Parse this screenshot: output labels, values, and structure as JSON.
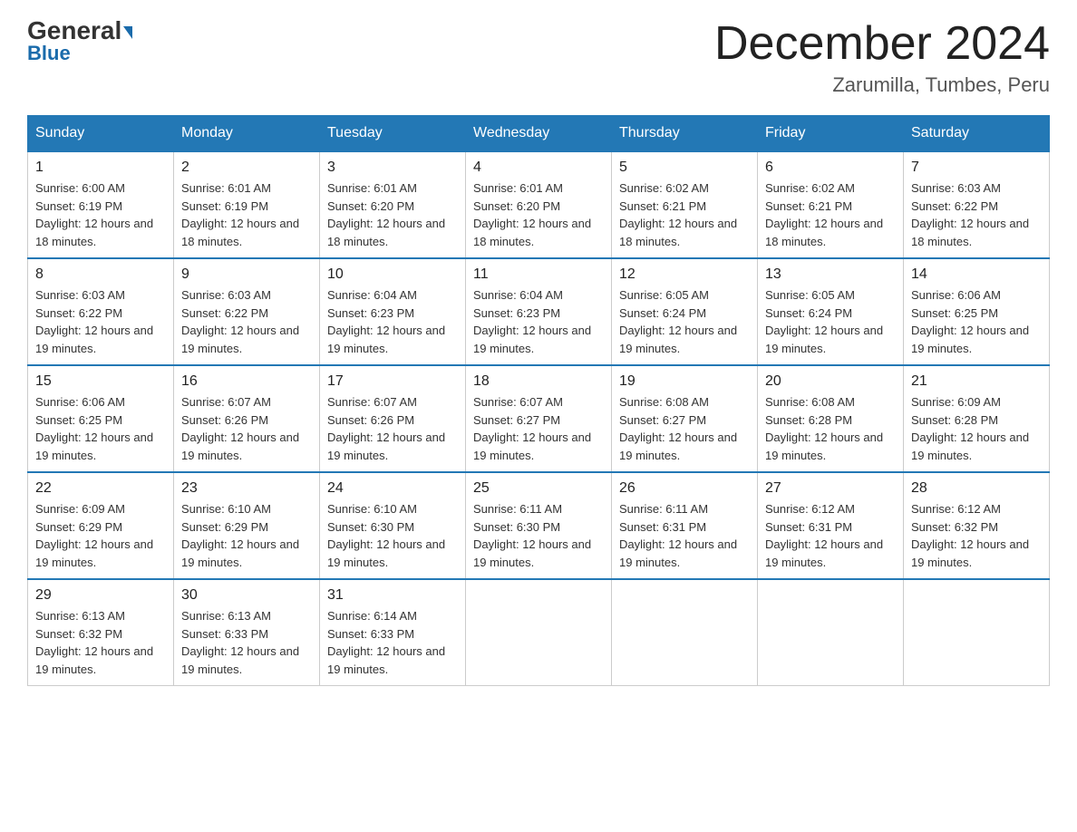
{
  "header": {
    "logo_text_general": "General",
    "logo_text_blue": "Blue",
    "month_title": "December 2024",
    "location": "Zarumilla, Tumbes, Peru"
  },
  "weekdays": [
    "Sunday",
    "Monday",
    "Tuesday",
    "Wednesday",
    "Thursday",
    "Friday",
    "Saturday"
  ],
  "weeks": [
    [
      {
        "day": "1",
        "sunrise": "6:00 AM",
        "sunset": "6:19 PM",
        "daylight": "12 hours and 18 minutes."
      },
      {
        "day": "2",
        "sunrise": "6:01 AM",
        "sunset": "6:19 PM",
        "daylight": "12 hours and 18 minutes."
      },
      {
        "day": "3",
        "sunrise": "6:01 AM",
        "sunset": "6:20 PM",
        "daylight": "12 hours and 18 minutes."
      },
      {
        "day": "4",
        "sunrise": "6:01 AM",
        "sunset": "6:20 PM",
        "daylight": "12 hours and 18 minutes."
      },
      {
        "day": "5",
        "sunrise": "6:02 AM",
        "sunset": "6:21 PM",
        "daylight": "12 hours and 18 minutes."
      },
      {
        "day": "6",
        "sunrise": "6:02 AM",
        "sunset": "6:21 PM",
        "daylight": "12 hours and 18 minutes."
      },
      {
        "day": "7",
        "sunrise": "6:03 AM",
        "sunset": "6:22 PM",
        "daylight": "12 hours and 18 minutes."
      }
    ],
    [
      {
        "day": "8",
        "sunrise": "6:03 AM",
        "sunset": "6:22 PM",
        "daylight": "12 hours and 19 minutes."
      },
      {
        "day": "9",
        "sunrise": "6:03 AM",
        "sunset": "6:22 PM",
        "daylight": "12 hours and 19 minutes."
      },
      {
        "day": "10",
        "sunrise": "6:04 AM",
        "sunset": "6:23 PM",
        "daylight": "12 hours and 19 minutes."
      },
      {
        "day": "11",
        "sunrise": "6:04 AM",
        "sunset": "6:23 PM",
        "daylight": "12 hours and 19 minutes."
      },
      {
        "day": "12",
        "sunrise": "6:05 AM",
        "sunset": "6:24 PM",
        "daylight": "12 hours and 19 minutes."
      },
      {
        "day": "13",
        "sunrise": "6:05 AM",
        "sunset": "6:24 PM",
        "daylight": "12 hours and 19 minutes."
      },
      {
        "day": "14",
        "sunrise": "6:06 AM",
        "sunset": "6:25 PM",
        "daylight": "12 hours and 19 minutes."
      }
    ],
    [
      {
        "day": "15",
        "sunrise": "6:06 AM",
        "sunset": "6:25 PM",
        "daylight": "12 hours and 19 minutes."
      },
      {
        "day": "16",
        "sunrise": "6:07 AM",
        "sunset": "6:26 PM",
        "daylight": "12 hours and 19 minutes."
      },
      {
        "day": "17",
        "sunrise": "6:07 AM",
        "sunset": "6:26 PM",
        "daylight": "12 hours and 19 minutes."
      },
      {
        "day": "18",
        "sunrise": "6:07 AM",
        "sunset": "6:27 PM",
        "daylight": "12 hours and 19 minutes."
      },
      {
        "day": "19",
        "sunrise": "6:08 AM",
        "sunset": "6:27 PM",
        "daylight": "12 hours and 19 minutes."
      },
      {
        "day": "20",
        "sunrise": "6:08 AM",
        "sunset": "6:28 PM",
        "daylight": "12 hours and 19 minutes."
      },
      {
        "day": "21",
        "sunrise": "6:09 AM",
        "sunset": "6:28 PM",
        "daylight": "12 hours and 19 minutes."
      }
    ],
    [
      {
        "day": "22",
        "sunrise": "6:09 AM",
        "sunset": "6:29 PM",
        "daylight": "12 hours and 19 minutes."
      },
      {
        "day": "23",
        "sunrise": "6:10 AM",
        "sunset": "6:29 PM",
        "daylight": "12 hours and 19 minutes."
      },
      {
        "day": "24",
        "sunrise": "6:10 AM",
        "sunset": "6:30 PM",
        "daylight": "12 hours and 19 minutes."
      },
      {
        "day": "25",
        "sunrise": "6:11 AM",
        "sunset": "6:30 PM",
        "daylight": "12 hours and 19 minutes."
      },
      {
        "day": "26",
        "sunrise": "6:11 AM",
        "sunset": "6:31 PM",
        "daylight": "12 hours and 19 minutes."
      },
      {
        "day": "27",
        "sunrise": "6:12 AM",
        "sunset": "6:31 PM",
        "daylight": "12 hours and 19 minutes."
      },
      {
        "day": "28",
        "sunrise": "6:12 AM",
        "sunset": "6:32 PM",
        "daylight": "12 hours and 19 minutes."
      }
    ],
    [
      {
        "day": "29",
        "sunrise": "6:13 AM",
        "sunset": "6:32 PM",
        "daylight": "12 hours and 19 minutes."
      },
      {
        "day": "30",
        "sunrise": "6:13 AM",
        "sunset": "6:33 PM",
        "daylight": "12 hours and 19 minutes."
      },
      {
        "day": "31",
        "sunrise": "6:14 AM",
        "sunset": "6:33 PM",
        "daylight": "12 hours and 19 minutes."
      },
      null,
      null,
      null,
      null
    ]
  ]
}
